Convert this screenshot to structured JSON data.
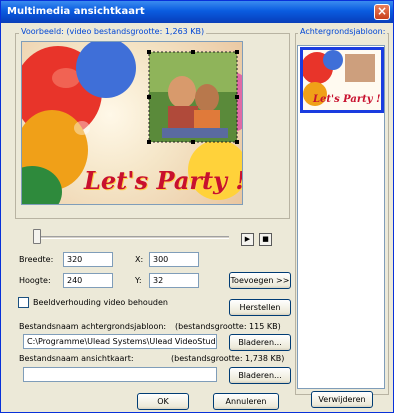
{
  "window": {
    "title": "Multimedia ansichtkaart",
    "close_symbol": "×"
  },
  "preview": {
    "group_label": "Voorbeeld: (video bestandsgrootte: 1,263 KB)",
    "card_text": "Let's Party !"
  },
  "templates": {
    "group_label": "Achtergrondsjabloon:",
    "items": [
      {
        "text": "Let's Party !",
        "selected": true
      }
    ],
    "selection_color": "#1a3ce0"
  },
  "playback": {
    "play_symbol": "▶",
    "stop_symbol": "■"
  },
  "dimensions": {
    "width_label": "Breedte:",
    "width_value": "320",
    "height_label": "Hoogte:",
    "height_value": "240",
    "x_label": "X:",
    "x_value": "300",
    "y_label": "Y:",
    "y_value": "32"
  },
  "buttons": {
    "add": "Toevoegen >>",
    "reset": "Herstellen",
    "browse_bg": "Bladeren...",
    "browse_card": "Bladeren...",
    "ok": "OK",
    "cancel": "Annuleren",
    "remove": "Verwijderen"
  },
  "aspect_checkbox": {
    "label": "Beeldverhouding video behouden",
    "checked": false
  },
  "background_file": {
    "label": "Bestandsnaam achtergrondsjabloon:",
    "size_label": "(bestandsgrootte: 115 KB)",
    "path": "C:\\Programme\\Ulead Systems\\Ulead VideoStud"
  },
  "card_file": {
    "label": "Bestandsnaam ansichtkaart:",
    "size_label": "(bestandsgrootte: 1,738 KB)",
    "path": ""
  },
  "colors": {
    "title_bar": "#0a5ce0",
    "accent_red": "#c8102e",
    "group_label": "#0046d5"
  }
}
